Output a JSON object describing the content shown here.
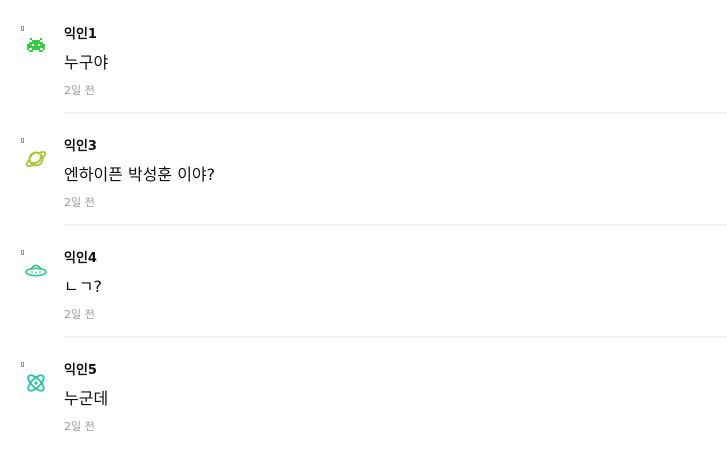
{
  "comments": [
    {
      "author": "익인1",
      "text": "누구야",
      "time": "2일 전",
      "avatar_icon": "space-invader-icon",
      "avatar_color": "#3cc94a"
    },
    {
      "author": "익인3",
      "text": "엔하이픈 박성훈 이야?",
      "time": "2일 전",
      "avatar_icon": "planet-icon",
      "avatar_color": "#a6c93a"
    },
    {
      "author": "익인4",
      "text": "ㄴㄱ?",
      "time": "2일 전",
      "avatar_icon": "ufo-icon",
      "avatar_color": "#3fc79a"
    },
    {
      "author": "익인5",
      "text": "누군데",
      "time": "2일 전",
      "avatar_icon": "atom-icon",
      "avatar_color": "#2bbfa6"
    }
  ]
}
